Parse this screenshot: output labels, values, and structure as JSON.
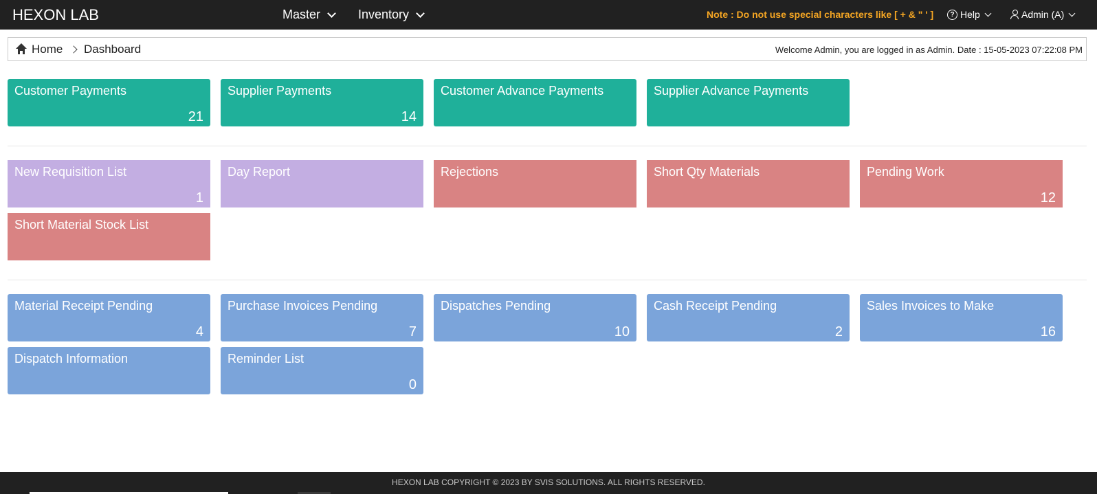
{
  "header": {
    "brand": "HEXON LAB",
    "nav": [
      {
        "label": "Master"
      },
      {
        "label": "Inventory"
      }
    ],
    "note": "Note : Do not use special characters like [ + & \" ' ]",
    "help_label": "Help",
    "admin_label": "Admin (A)",
    "note_color": "#f5a623"
  },
  "breadcrumb": {
    "home": "Home",
    "current": "Dashboard",
    "welcome": "Welcome Admin, you are logged in as Admin. Date : 15-05-2023 07:22:08 PM"
  },
  "sections": {
    "payments": [
      {
        "title": "Customer Payments",
        "count": "21",
        "color": "#1fb09a"
      },
      {
        "title": "Supplier Payments",
        "count": "14",
        "color": "#1fb09a"
      },
      {
        "title": "Customer Advance Payments",
        "count": "",
        "color": "#1fb09a"
      },
      {
        "title": "Supplier Advance Payments",
        "count": "",
        "color": "#1fb09a"
      }
    ],
    "work": [
      {
        "title": "New Requisition List",
        "count": "1",
        "color": "#c3aee2"
      },
      {
        "title": "Day Report",
        "count": "",
        "color": "#c3aee2"
      },
      {
        "title": "Rejections",
        "count": "",
        "color": "#d98383"
      },
      {
        "title": "Short Qty Materials",
        "count": "",
        "color": "#d98383"
      },
      {
        "title": "Pending Work",
        "count": "12",
        "color": "#d98383"
      },
      {
        "title": "Short Material Stock List",
        "count": "",
        "color": "#d98383"
      }
    ],
    "pending": [
      {
        "title": "Material Receipt Pending",
        "count": "4",
        "color": "#7ba4da"
      },
      {
        "title": "Purchase Invoices Pending",
        "count": "7",
        "color": "#7ba4da"
      },
      {
        "title": "Dispatches Pending",
        "count": "10",
        "color": "#7ba4da"
      },
      {
        "title": "Cash Receipt Pending",
        "count": "2",
        "color": "#7ba4da"
      },
      {
        "title": "Sales Invoices to Make",
        "count": "16",
        "color": "#7ba4da"
      },
      {
        "title": "Dispatch Information",
        "count": "",
        "color": "#7ba4da"
      },
      {
        "title": "Reminder List",
        "count": "0",
        "color": "#7ba4da"
      }
    ]
  },
  "footer": {
    "text": "HEXON LAB COPYRIGHT © 2023 BY SVIS SOLUTIONS. ALL RIGHTS RESERVED."
  }
}
